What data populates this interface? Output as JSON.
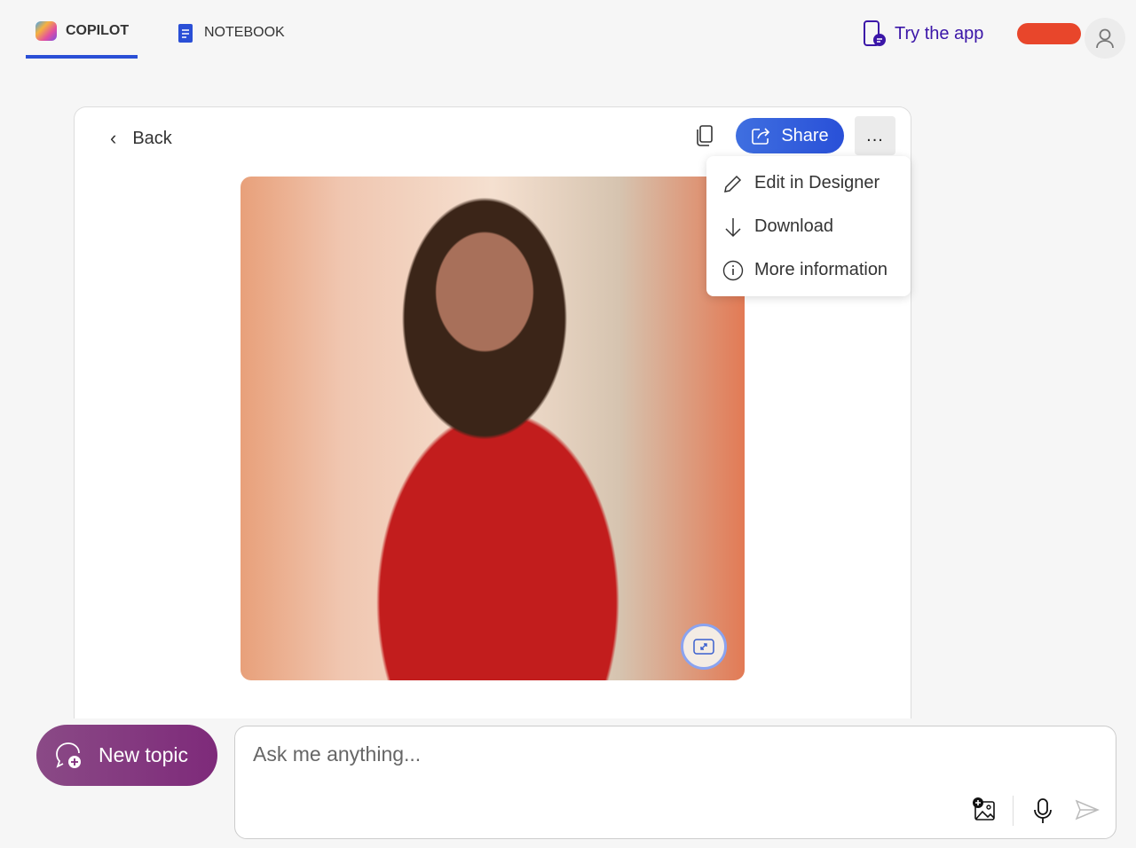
{
  "nav": {
    "tabs": [
      {
        "label": "COPILOT",
        "active": true
      },
      {
        "label": "NOTEBOOK",
        "active": false
      }
    ],
    "try_app": "Try the app"
  },
  "card": {
    "back": "Back",
    "share": "Share",
    "more": "...",
    "image_alt": "Generated image of a girl in a red sari in a market street"
  },
  "menu": {
    "items": [
      {
        "label": "Edit in Designer",
        "icon": "pencil-icon"
      },
      {
        "label": "Download",
        "icon": "download-icon"
      },
      {
        "label": "More information",
        "icon": "info-icon"
      }
    ]
  },
  "composer": {
    "new_topic": "New topic",
    "placeholder": "Ask me anything..."
  },
  "colors": {
    "accent": "#2950d8",
    "new_topic": "#7e2a7a",
    "try_app": "#3b16a8"
  }
}
